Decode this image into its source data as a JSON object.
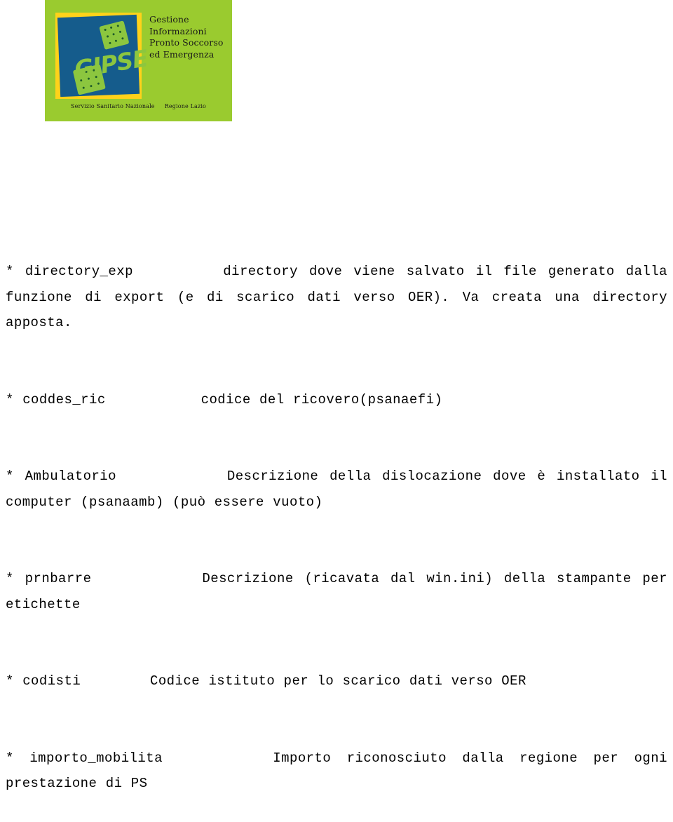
{
  "logo": {
    "alt_name": "gipse-logo",
    "wordmark": "GIPSE",
    "headline_lines": [
      "Gestione",
      "Informazioni",
      "Pronto Soccorso",
      "ed Emergenza"
    ],
    "footer_left": "Servizio Sanitario Nazionale",
    "footer_right": "Regione Lazio",
    "colors": {
      "background_green": "#9ACB2F",
      "mat_yellow": "#FFD21A",
      "square_blue": "#155C8C",
      "wordmark_green": "#8CC63F",
      "dot_dark_green": "#1F5C2A"
    }
  },
  "content": {
    "paragraphs": [
      "* directory_exp        directory dove viene salvato il file generato dalla funzione di export (e di scarico dati verso OER). Va creata una directory apposta.",
      "* coddes_ric           codice del ricovero(psanaefi)",
      "* Ambulatorio          Descrizione della dislocazione dove è installato il computer (psanaamb) (può essere vuoto)",
      "* prnbarre          Descrizione (ricavata dal win.ini) della stampante per etichette",
      "* codisti        Codice istituto per lo scarico dati verso OER",
      "* importo_mobilita       Importo riconosciuto dalla regione per ogni prestazione di PS"
    ]
  }
}
